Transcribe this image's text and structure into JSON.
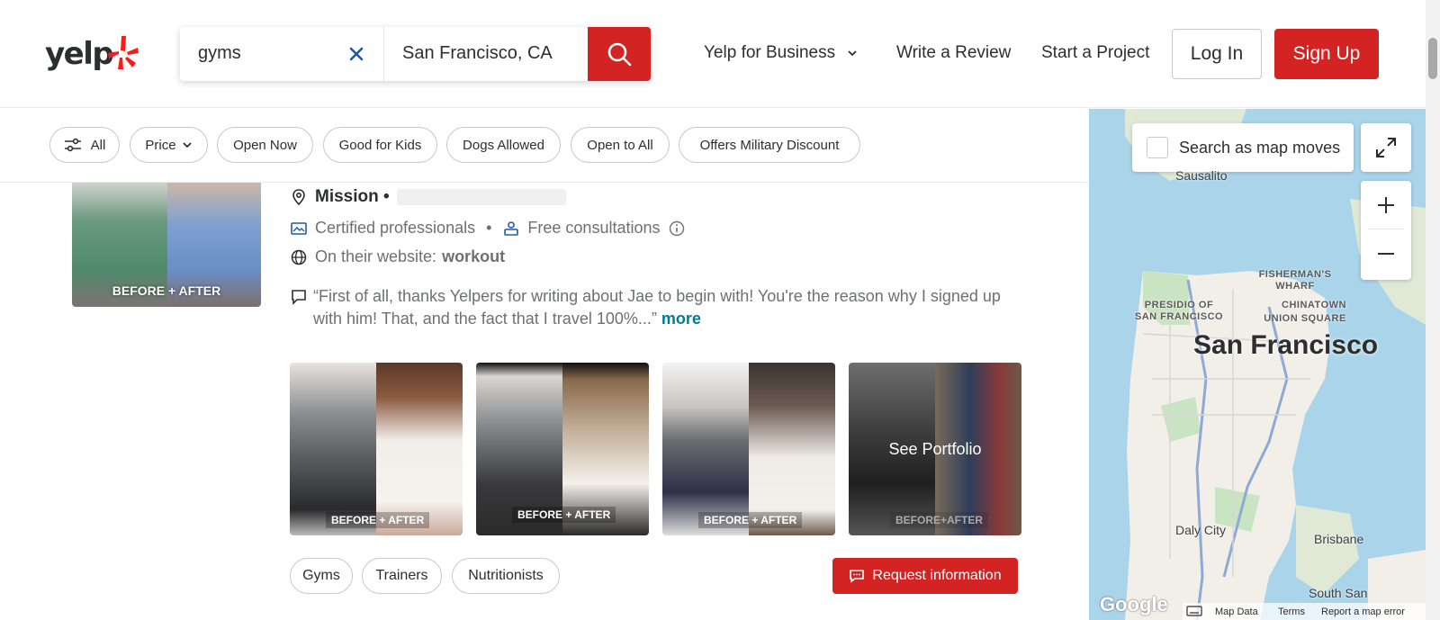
{
  "header": {
    "logo_text": "yelp",
    "search": {
      "find_value": "gyms",
      "near_value": "San Francisco, CA"
    },
    "nav": {
      "business": "Yelp for Business",
      "review": "Write a Review",
      "project": "Start a Project"
    },
    "login": "Log In",
    "signup": "Sign Up"
  },
  "filters": [
    "All",
    "Price",
    "Open Now",
    "Good for Kids",
    "Dogs Allowed",
    "Open to All",
    "Offers Military Discount"
  ],
  "listing": {
    "thumb_label": "BEFORE + AFTER",
    "location": "Mission •",
    "certified": "Certified professionals",
    "dot": "•",
    "consult": "Free consultations",
    "website_prefix": "On their website:",
    "website_keyword": "workout",
    "quote": "“First of all, thanks Yelpers for writing about Jae to begin with! You're the reason why I signed up with him! That, and the fact that I travel 100%...”",
    "quote_more": "more",
    "photos": [
      {
        "label": "BEFORE + AFTER"
      },
      {
        "label": "BEFORE + AFTER"
      },
      {
        "label": "BEFORE + AFTER"
      },
      {
        "label": "BEFORE+AFTER",
        "overlay": "See Portfolio"
      }
    ],
    "tags": [
      "Gyms",
      "Trainers",
      "Nutritionists"
    ],
    "request": "Request information"
  },
  "map": {
    "toggle": "Search as map moves",
    "city": "San Francisco",
    "labels": {
      "sausalito": "Sausalito",
      "fishermans": "FISHERMAN'S WHARF",
      "presidio": "PRESIDIO OF SAN FRANCISCO",
      "chinatown": "CHINATOWN",
      "union": "UNION SQUARE",
      "daly": "Daly City",
      "brisbane": "Brisbane",
      "southsan": "South San"
    },
    "footer": {
      "google": "Google",
      "data": "Map Data",
      "terms": "Terms",
      "report": "Report a map error"
    }
  },
  "colors": {
    "brand_red": "#d32323",
    "link_teal": "#027a97",
    "text": "#2d2e2f",
    "muted": "#6e7072"
  }
}
